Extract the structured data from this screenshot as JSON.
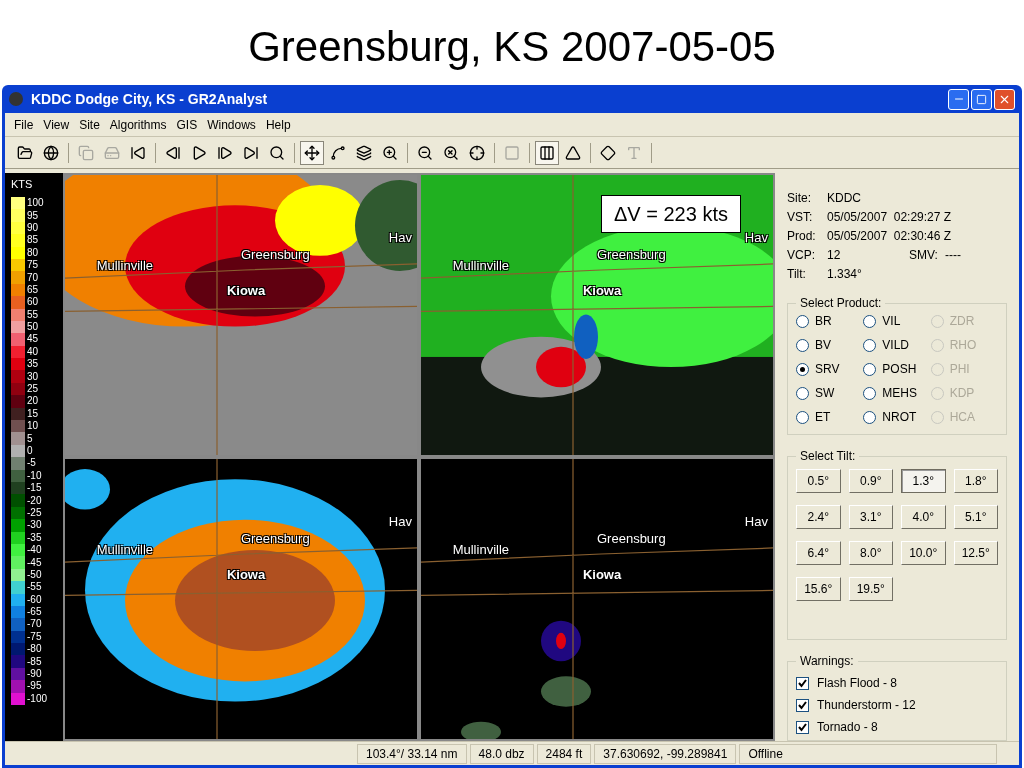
{
  "slide_title": "Greensburg, KS 2007-05-05",
  "window": {
    "title": "KDDC Dodge City, KS - GR2Analyst"
  },
  "menu": [
    "File",
    "View",
    "Site",
    "Algorithms",
    "GIS",
    "Windows",
    "Help"
  ],
  "toolbar": [
    {
      "selected": false,
      "disabled": false
    },
    {
      "selected": false,
      "disabled": false
    },
    {
      "selected": false,
      "disabled": true
    },
    {
      "selected": false,
      "disabled": true
    },
    {
      "selected": false,
      "disabled": false
    },
    {
      "selected": false,
      "disabled": false
    },
    {
      "selected": false,
      "disabled": false
    },
    {
      "selected": false,
      "disabled": false
    },
    {
      "selected": false,
      "disabled": false
    },
    {
      "selected": false,
      "disabled": false
    },
    {
      "selected": true,
      "disabled": false
    },
    {
      "selected": false,
      "disabled": false
    },
    {
      "selected": false,
      "disabled": false
    },
    {
      "selected": false,
      "disabled": false
    },
    {
      "selected": false,
      "disabled": false
    },
    {
      "selected": false,
      "disabled": false
    },
    {
      "selected": false,
      "disabled": false
    },
    {
      "selected": false,
      "disabled": true
    },
    {
      "selected": true,
      "disabled": false
    },
    {
      "selected": false,
      "disabled": false
    },
    {
      "selected": false,
      "disabled": false
    },
    {
      "selected": false,
      "disabled": true
    }
  ],
  "color_scale": {
    "unit": "KTS",
    "steps": [
      {
        "label": "100",
        "color": "#ffff80"
      },
      {
        "label": "95",
        "color": "#ffff60"
      },
      {
        "label": "90",
        "color": "#ffff40"
      },
      {
        "label": "85",
        "color": "#ffff20"
      },
      {
        "label": "80",
        "color": "#ffff00"
      },
      {
        "label": "75",
        "color": "#f8c800"
      },
      {
        "label": "70",
        "color": "#f0a000"
      },
      {
        "label": "65",
        "color": "#f08000"
      },
      {
        "label": "60",
        "color": "#e86020"
      },
      {
        "label": "55",
        "color": "#f08070"
      },
      {
        "label": "50",
        "color": "#f0a0a0"
      },
      {
        "label": "45",
        "color": "#f06070"
      },
      {
        "label": "40",
        "color": "#f02030"
      },
      {
        "label": "35",
        "color": "#e00010"
      },
      {
        "label": "30",
        "color": "#b00010"
      },
      {
        "label": "25",
        "color": "#900010"
      },
      {
        "label": "20",
        "color": "#600010"
      },
      {
        "label": "15",
        "color": "#402020"
      },
      {
        "label": "10",
        "color": "#705050"
      },
      {
        "label": "5",
        "color": "#a09090"
      },
      {
        "label": "0",
        "color": "#b0b0b0"
      },
      {
        "label": "-5",
        "color": "#708070"
      },
      {
        "label": "-10",
        "color": "#406040"
      },
      {
        "label": "-15",
        "color": "#204020"
      },
      {
        "label": "-20",
        "color": "#005000"
      },
      {
        "label": "-25",
        "color": "#007000"
      },
      {
        "label": "-30",
        "color": "#00a000"
      },
      {
        "label": "-35",
        "color": "#20d020"
      },
      {
        "label": "-40",
        "color": "#40f040"
      },
      {
        "label": "-45",
        "color": "#60f060"
      },
      {
        "label": "-50",
        "color": "#90f090"
      },
      {
        "label": "-55",
        "color": "#40d0d0"
      },
      {
        "label": "-60",
        "color": "#20b0f0"
      },
      {
        "label": "-65",
        "color": "#1080e0"
      },
      {
        "label": "-70",
        "color": "#1060c0"
      },
      {
        "label": "-75",
        "color": "#003090"
      },
      {
        "label": "-80",
        "color": "#001870"
      },
      {
        "label": "-85",
        "color": "#200880"
      },
      {
        "label": "-90",
        "color": "#6010a0"
      },
      {
        "label": "-95",
        "color": "#a010b0"
      },
      {
        "label": "-100",
        "color": "#e010d0"
      }
    ]
  },
  "panels": [
    {
      "labels": [
        "Mullinville",
        "Greensburg",
        "Kiowa",
        "Hav"
      ]
    },
    {
      "labels": [
        "Mullinville",
        "Greensburg",
        "Kiowa",
        "Hav"
      ]
    },
    {
      "labels": [
        "Mullinville",
        "Greensburg",
        "Kiowa",
        "Hav"
      ]
    },
    {
      "labels": [
        "Mullinville",
        "Greensburg",
        "Kiowa",
        "Hav"
      ]
    }
  ],
  "annotation": "ΔV = 223 kts",
  "info": [
    {
      "label": "Site:",
      "value": "KDDC"
    },
    {
      "label": "VST:",
      "value": "05/05/2007  02:29:27 Z"
    },
    {
      "label": "Prod:",
      "value": "05/05/2007  02:30:46 Z"
    },
    {
      "label": "VCP:",
      "value": "12",
      "extra_label": "SMV:",
      "extra_value": "----"
    },
    {
      "label": "Tilt:",
      "value": "1.334°"
    }
  ],
  "select_product": {
    "title": "Select Product:",
    "options": [
      {
        "label": "BR",
        "selected": false,
        "disabled": false
      },
      {
        "label": "VIL",
        "selected": false,
        "disabled": false
      },
      {
        "label": "ZDR",
        "selected": false,
        "disabled": true
      },
      {
        "label": "BV",
        "selected": false,
        "disabled": false
      },
      {
        "label": "VILD",
        "selected": false,
        "disabled": false
      },
      {
        "label": "RHO",
        "selected": false,
        "disabled": true
      },
      {
        "label": "SRV",
        "selected": true,
        "disabled": false
      },
      {
        "label": "POSH",
        "selected": false,
        "disabled": false
      },
      {
        "label": "PHI",
        "selected": false,
        "disabled": true
      },
      {
        "label": "SW",
        "selected": false,
        "disabled": false
      },
      {
        "label": "MEHS",
        "selected": false,
        "disabled": false
      },
      {
        "label": "KDP",
        "selected": false,
        "disabled": true
      },
      {
        "label": "ET",
        "selected": false,
        "disabled": false
      },
      {
        "label": "NROT",
        "selected": false,
        "disabled": false
      },
      {
        "label": "HCA",
        "selected": false,
        "disabled": true
      }
    ]
  },
  "select_tilt": {
    "title": "Select Tilt:",
    "tilts": [
      {
        "label": "0.5°",
        "selected": false
      },
      {
        "label": "0.9°",
        "selected": false
      },
      {
        "label": "1.3°",
        "selected": true
      },
      {
        "label": "1.8°",
        "selected": false
      },
      {
        "label": "2.4°",
        "selected": false
      },
      {
        "label": "3.1°",
        "selected": false
      },
      {
        "label": "4.0°",
        "selected": false
      },
      {
        "label": "5.1°",
        "selected": false
      },
      {
        "label": "6.4°",
        "selected": false
      },
      {
        "label": "8.0°",
        "selected": false
      },
      {
        "label": "10.0°",
        "selected": false
      },
      {
        "label": "12.5°",
        "selected": false
      },
      {
        "label": "15.6°",
        "selected": false
      },
      {
        "label": "19.5°",
        "selected": false
      }
    ]
  },
  "warnings": {
    "title": "Warnings:",
    "items": [
      {
        "label": "Flash Flood - 8",
        "checked": true
      },
      {
        "label": "Thunderstorm - 12",
        "checked": true
      },
      {
        "label": "Tornado - 8",
        "checked": true
      }
    ]
  },
  "status_bar": [
    "103.4°/ 33.14 nm",
    "48.0 dbz",
    "2484 ft",
    "37.630692, -99.289841",
    "Offline"
  ]
}
